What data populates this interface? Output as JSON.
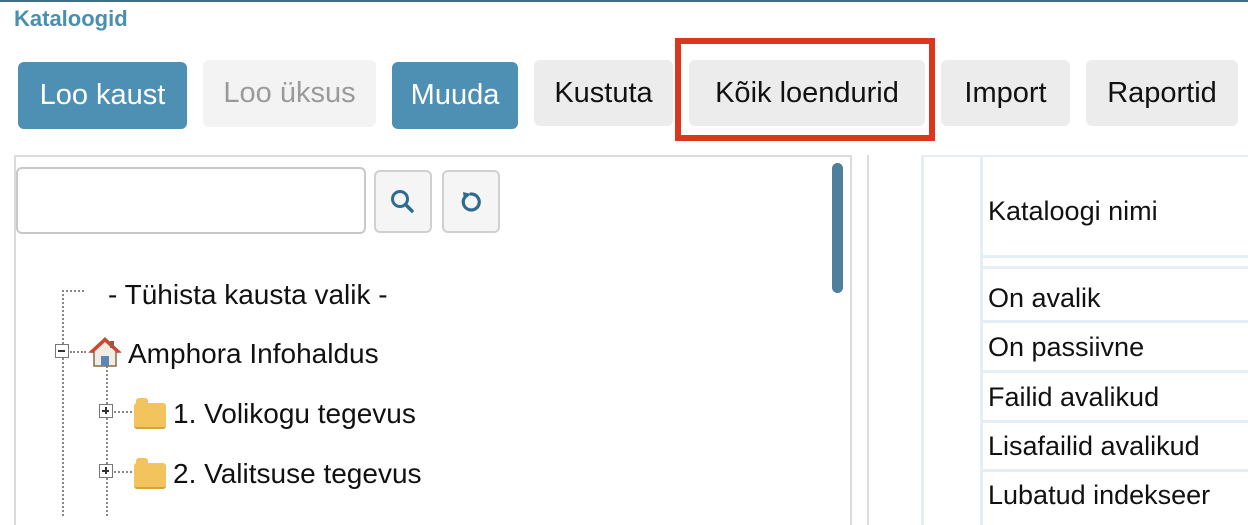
{
  "page": {
    "title": "Kataloogid"
  },
  "toolbar": {
    "create_folder": "Loo kaust",
    "create_unit": "Loo üksus",
    "edit": "Muuda",
    "delete": "Kustuta",
    "all_counters": "Kõik loendurid",
    "import": "Import",
    "reports": "Raportid"
  },
  "tree": {
    "search_value": "",
    "search_icon": "search-icon",
    "reset_icon": "refresh-icon",
    "clear_selection": "- Tühista kausta valik -",
    "root": "Amphora Infohaldus",
    "children": [
      "1. Volikogu tegevus",
      "2. Valitsuse tegevus"
    ]
  },
  "details": {
    "header": "Kataloogi nimi",
    "rows": [
      "On avalik",
      "On passiivne",
      "Failid avalikud",
      "Lisafailid avalikud",
      "Lubatud indekseer"
    ]
  },
  "colors": {
    "primary": "#4e8fb4",
    "highlight": "#d9381e",
    "title": "#4a8fb0"
  }
}
